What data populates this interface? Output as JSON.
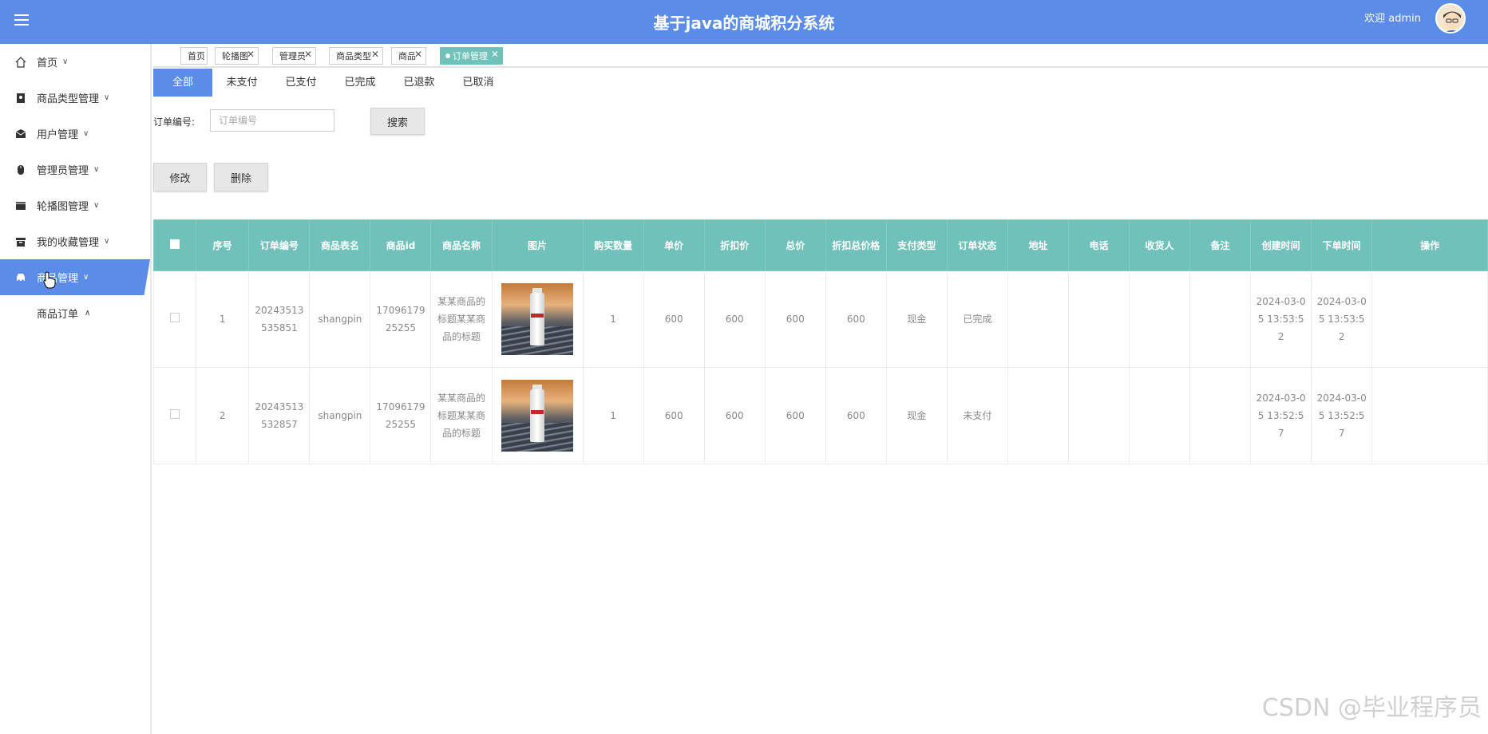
{
  "app": {
    "title": "基于java的商城积分系统",
    "welcome": "欢迎 admin",
    "accent_color": "#5a8ce8",
    "teal_color": "#70c1b9"
  },
  "sidebar": {
    "items": [
      {
        "label": "首页",
        "icon": "home-icon"
      },
      {
        "label": "商品类型管理",
        "icon": "category-icon"
      },
      {
        "label": "用户管理",
        "icon": "mail-icon"
      },
      {
        "label": "管理员管理",
        "icon": "mouse-icon"
      },
      {
        "label": "轮播图管理",
        "icon": "slides-icon"
      },
      {
        "label": "我的收藏管理",
        "icon": "box-icon"
      },
      {
        "label": "商品管理",
        "icon": "car-icon"
      }
    ],
    "sub_item": "商品订单"
  },
  "tabs": [
    "首页",
    "轮播图",
    "管理员",
    "商品类型",
    "商品",
    "订单管理"
  ],
  "status_tabs": [
    "全部",
    "未支付",
    "已支付",
    "已完成",
    "已退款",
    "已取消"
  ],
  "search": {
    "label": "订单编号:",
    "placeholder": "订单编号",
    "button": "搜索"
  },
  "actions": {
    "edit": "修改",
    "delete": "删除"
  },
  "table": {
    "columns": [
      "序号",
      "订单编号",
      "商品表名",
      "商品id",
      "商品名称",
      "图片",
      "购买数量",
      "单价",
      "折扣价",
      "总价",
      "折扣总价格",
      "支付类型",
      "订单状态",
      "地址",
      "电话",
      "收货人",
      "备注",
      "创建时间",
      "下单时间",
      "操作"
    ],
    "rows": [
      {
        "index": "1",
        "order_no": "20243513535851",
        "table_name": "shangpin",
        "goods_id": "1709617925255",
        "goods_name": "某某商品的标题某某商品的标题",
        "qty": "1",
        "price": "600",
        "discount_price": "600",
        "total": "600",
        "discount_total": "600",
        "pay_type": "现金",
        "status": "已完成",
        "address": "",
        "phone": "",
        "receiver": "",
        "remark": "",
        "created": "2024-03-05 13:53:52",
        "ordered": "2024-03-05 13:53:52"
      },
      {
        "index": "2",
        "order_no": "20243513532857",
        "table_name": "shangpin",
        "goods_id": "1709617925255",
        "goods_name": "某某商品的标题某某商品的标题",
        "qty": "1",
        "price": "600",
        "discount_price": "600",
        "total": "600",
        "discount_total": "600",
        "pay_type": "现金",
        "status": "未支付",
        "address": "",
        "phone": "",
        "receiver": "",
        "remark": "",
        "created": "2024-03-05 13:52:57",
        "ordered": "2024-03-05 13:52:57"
      }
    ]
  },
  "watermark": "CSDN @毕业程序员"
}
